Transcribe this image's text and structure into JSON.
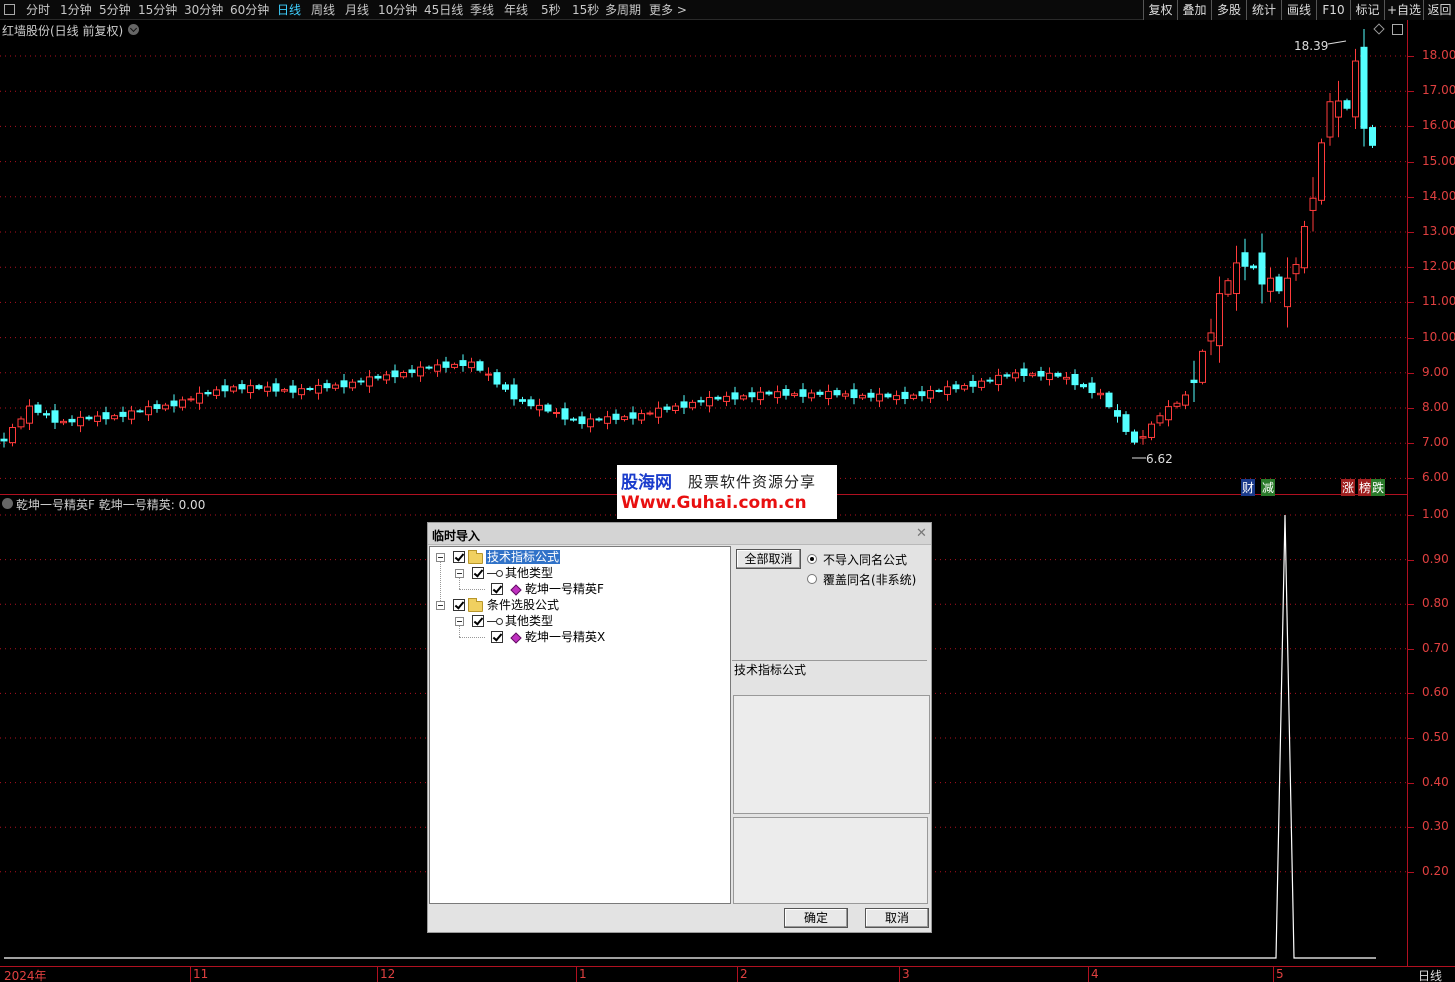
{
  "toolbar": {
    "periods": [
      "分时",
      "1分钟",
      "5分钟",
      "15分钟",
      "30分钟",
      "60分钟",
      "日线",
      "周线",
      "月线",
      "10分钟",
      "45日线",
      "季线",
      "年线",
      "5秒",
      "15秒",
      "多周期",
      "更多 >"
    ],
    "active_period": "日线",
    "right_buttons": [
      "复权",
      "叠加",
      "多股",
      "统计",
      "画线",
      "F10",
      "标记",
      "+自选",
      "返回"
    ]
  },
  "stock": {
    "title": "红墙股份(日线 前复权)",
    "high_label": "18.39",
    "low_label": "6.62"
  },
  "price_axis": [
    "18.00",
    "17.00",
    "16.00",
    "15.00",
    "14.00",
    "13.00",
    "12.00",
    "11.00",
    "10.00",
    "9.00",
    "8.00",
    "7.00",
    "6.00"
  ],
  "indicator": {
    "name": "乾坤一号精英F",
    "series_label": "乾坤一号精英:",
    "value": "0.00",
    "axis": [
      "1.00",
      "0.90",
      "0.80",
      "0.70",
      "0.60",
      "0.50",
      "0.40",
      "0.30",
      "0.20"
    ]
  },
  "time_axis": [
    "2024年",
    "11",
    "12",
    "1",
    "2",
    "3",
    "4",
    "5"
  ],
  "period_label": "日线",
  "tags": {
    "cai": "财",
    "jian": "减",
    "zhang": "涨",
    "bang": "榜",
    "die": "跌"
  },
  "colors": {
    "up": "#ff3b3b",
    "down": "#54ffff",
    "axis": "#b01020",
    "active": "#3fd0ff"
  },
  "watermark": {
    "logo": "股海网",
    "slogan": "股票软件资源分享",
    "url": "Www.Guhai.com.cn"
  },
  "dialog": {
    "title": "临时导入",
    "tree": {
      "group1": "技术指标公式",
      "group1_child": "其他类型",
      "group1_leaf": "乾坤一号精英F",
      "group2": "条件选股公式",
      "group2_child": "其他类型",
      "group2_leaf": "乾坤一号精英X"
    },
    "deselect_all": "全部取消",
    "option_no_import": "不导入同名公式",
    "option_overwrite": "覆盖同名(非系统)",
    "info_label": "技术指标公式",
    "ok": "确定",
    "cancel": "取消"
  }
}
